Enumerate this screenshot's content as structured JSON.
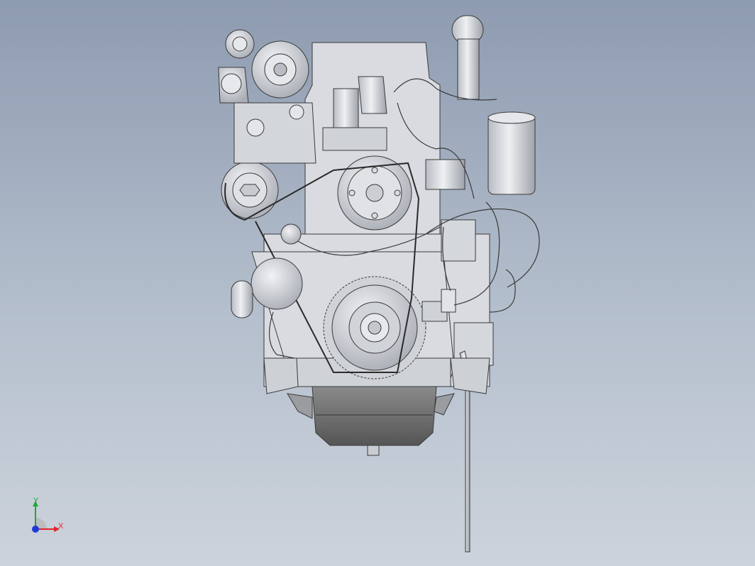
{
  "viewport": {
    "background_top": "#8e9bb0",
    "background_bottom": "#cdd3dc"
  },
  "model": {
    "part_color": "#d9dbe0",
    "edge_color": "#3a3a3a",
    "oil_pan_color": "#6c6c6c"
  },
  "triad": {
    "x_label": "X",
    "y_label": "Y",
    "x_color": "#e0242a",
    "y_color": "#1ea83a",
    "z_color": "#1f3bd6"
  }
}
